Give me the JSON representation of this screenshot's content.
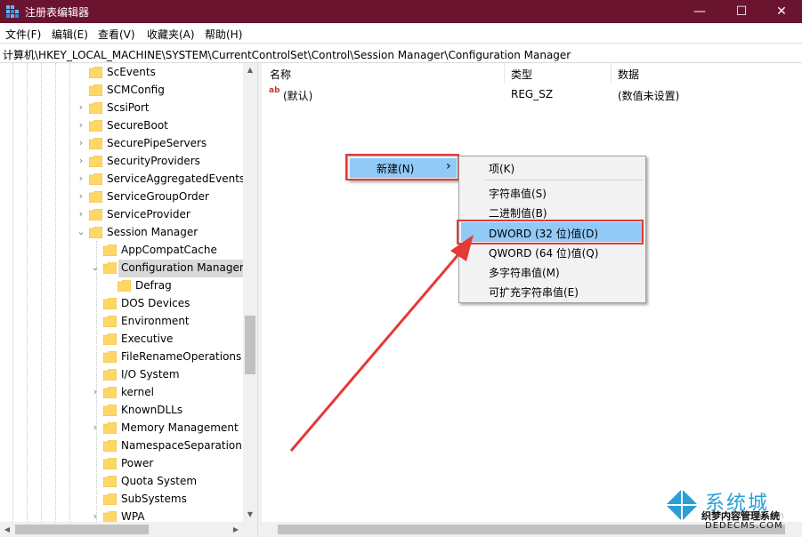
{
  "window": {
    "title": "注册表编辑器",
    "title_bg": "#6b1430",
    "minimize": "—",
    "maximize": "☐",
    "close": "✕"
  },
  "menu": [
    "文件(F)",
    "编辑(E)",
    "查看(V)",
    "收藏夹(A)",
    "帮助(H)"
  ],
  "address": "计算机\\HKEY_LOCAL_MACHINE\\SYSTEM\\CurrentControlSet\\Control\\Session Manager\\Configuration Manager",
  "tree": {
    "items": [
      {
        "label": "ScEvents",
        "expander": false
      },
      {
        "label": "SCMConfig",
        "expander": false
      },
      {
        "label": "ScsiPort",
        "expander": true
      },
      {
        "label": "SecureBoot",
        "expander": true
      },
      {
        "label": "SecurePipeServers",
        "expander": true
      },
      {
        "label": "SecurityProviders",
        "expander": true
      },
      {
        "label": "ServiceAggregatedEvents",
        "expander": true
      },
      {
        "label": "ServiceGroupOrder",
        "expander": true
      },
      {
        "label": "ServiceProvider",
        "expander": true
      },
      {
        "label": "Session Manager",
        "expander": "open"
      },
      {
        "label": "AppCompatCache",
        "expander": false
      },
      {
        "label": "Configuration Manager",
        "expander": "open",
        "selected": true
      },
      {
        "label": "Defrag",
        "expander": false
      },
      {
        "label": "DOS Devices",
        "expander": false
      },
      {
        "label": "Environment",
        "expander": false
      },
      {
        "label": "Executive",
        "expander": false
      },
      {
        "label": "FileRenameOperations",
        "expander": false
      },
      {
        "label": "I/O System",
        "expander": false
      },
      {
        "label": "kernel",
        "expander": true
      },
      {
        "label": "KnownDLLs",
        "expander": false
      },
      {
        "label": "Memory Management",
        "expander": true
      },
      {
        "label": "NamespaceSeparation",
        "expander": false
      },
      {
        "label": "Power",
        "expander": false
      },
      {
        "label": "Quota System",
        "expander": false
      },
      {
        "label": "SubSystems",
        "expander": false
      },
      {
        "label": "WPA",
        "expander": true
      }
    ]
  },
  "list": {
    "headers": {
      "name": "名称",
      "type": "类型",
      "data": "数据"
    },
    "rows": [
      {
        "icon": "ab",
        "name": "(默认)",
        "type": "REG_SZ",
        "data": "(数值未设置)"
      }
    ]
  },
  "context_menu": {
    "parent": {
      "label": "新建(N)",
      "arrow": "›"
    },
    "submenu": [
      {
        "label": "项(K)"
      },
      {
        "label": "字符串值(S)"
      },
      {
        "label": "二进制值(B)"
      },
      {
        "label": "DWORD (32 位)值(D)",
        "highlighted": true
      },
      {
        "label": "QWORD (64 位)值(Q)"
      },
      {
        "label": "多字符串值(M)"
      },
      {
        "label": "可扩充字符串值(E)"
      }
    ]
  },
  "watermark": {
    "text": "系统城",
    "sub": "织梦内容管理系统",
    "url": "DEDECMS.COM",
    "url2": "xitongcheng.com"
  },
  "colors": {
    "annotation_red": "#e53935",
    "menu_highlight": "#91c9f7"
  }
}
